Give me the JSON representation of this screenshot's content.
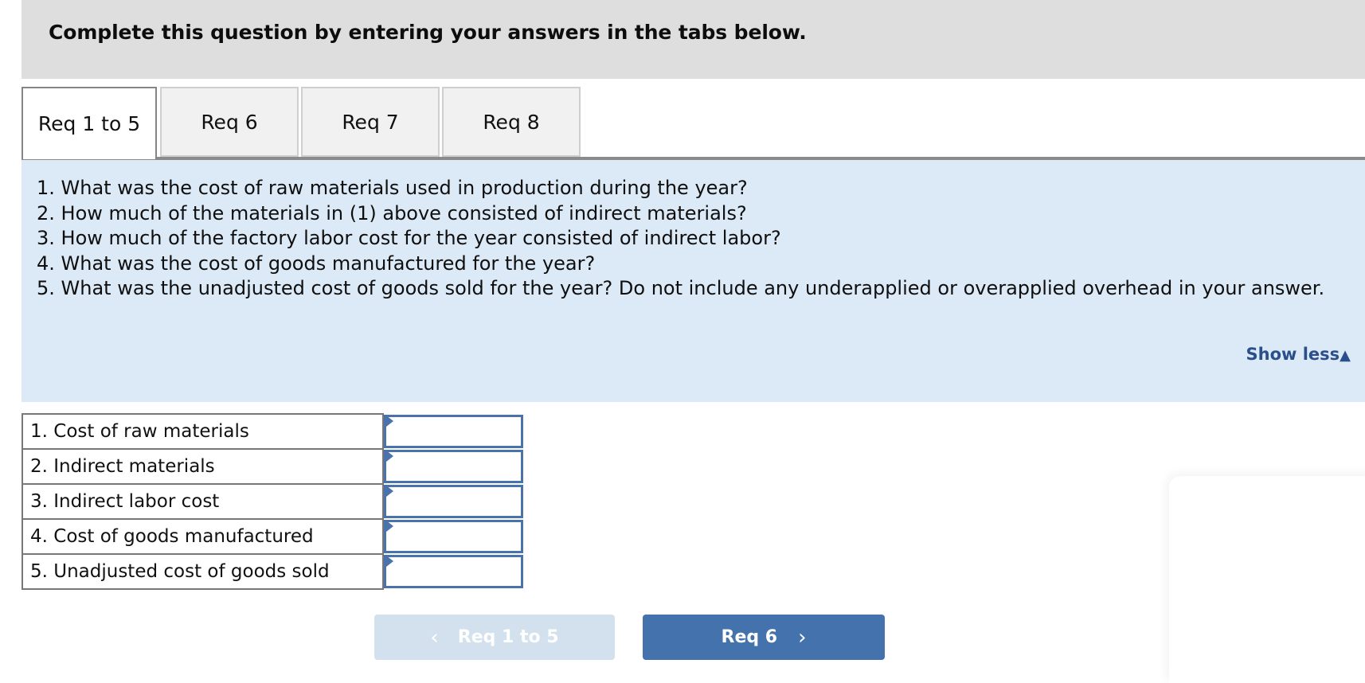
{
  "header": {
    "title": "Complete this question by entering your answers in the tabs below.",
    "background": "#dedede"
  },
  "tabs": {
    "active_index": 0,
    "items": [
      {
        "label": "Req 1 to 5",
        "active": true
      },
      {
        "label": "Req 6",
        "active": false
      },
      {
        "label": "Req 7",
        "active": false
      },
      {
        "label": "Req 8",
        "active": false
      }
    ]
  },
  "question_panel": {
    "background": "#dce9f6",
    "lines": [
      "1. What was the cost of raw materials used in production during the year?",
      "2. How much of the materials in (1) above consisted of indirect materials?",
      "3. How much of the factory labor cost for the year consisted of indirect labor?",
      "4. What was the cost of goods manufactured for the year?",
      "5. What was the unadjusted cost of goods sold for the year? Do not include any underapplied or overapplied overhead in your answer."
    ],
    "show_less_label": "Show less",
    "show_less_caret": "▲",
    "link_color": "#2a4f8a"
  },
  "answer_table": {
    "rows": [
      {
        "label": "1. Cost of raw materials",
        "value": "",
        "placeholder": ""
      },
      {
        "label": "2. Indirect materials",
        "value": "",
        "placeholder": ""
      },
      {
        "label": "3. Indirect labor cost",
        "value": "",
        "placeholder": ""
      },
      {
        "label": "4. Cost of goods manufactured",
        "value": "",
        "placeholder": ""
      },
      {
        "label": "5. Unadjusted cost of goods sold",
        "value": "",
        "placeholder": ""
      }
    ],
    "input_border_color": "#4a72ad"
  },
  "navigation": {
    "prev": {
      "label": "Req 1 to 5",
      "icon": "chevron-left",
      "glyph": "‹",
      "disabled": true,
      "background": "#d3e0ed"
    },
    "next": {
      "label": "Req 6",
      "icon": "chevron-right",
      "glyph": "›",
      "disabled": false,
      "background": "#4372ad"
    }
  }
}
